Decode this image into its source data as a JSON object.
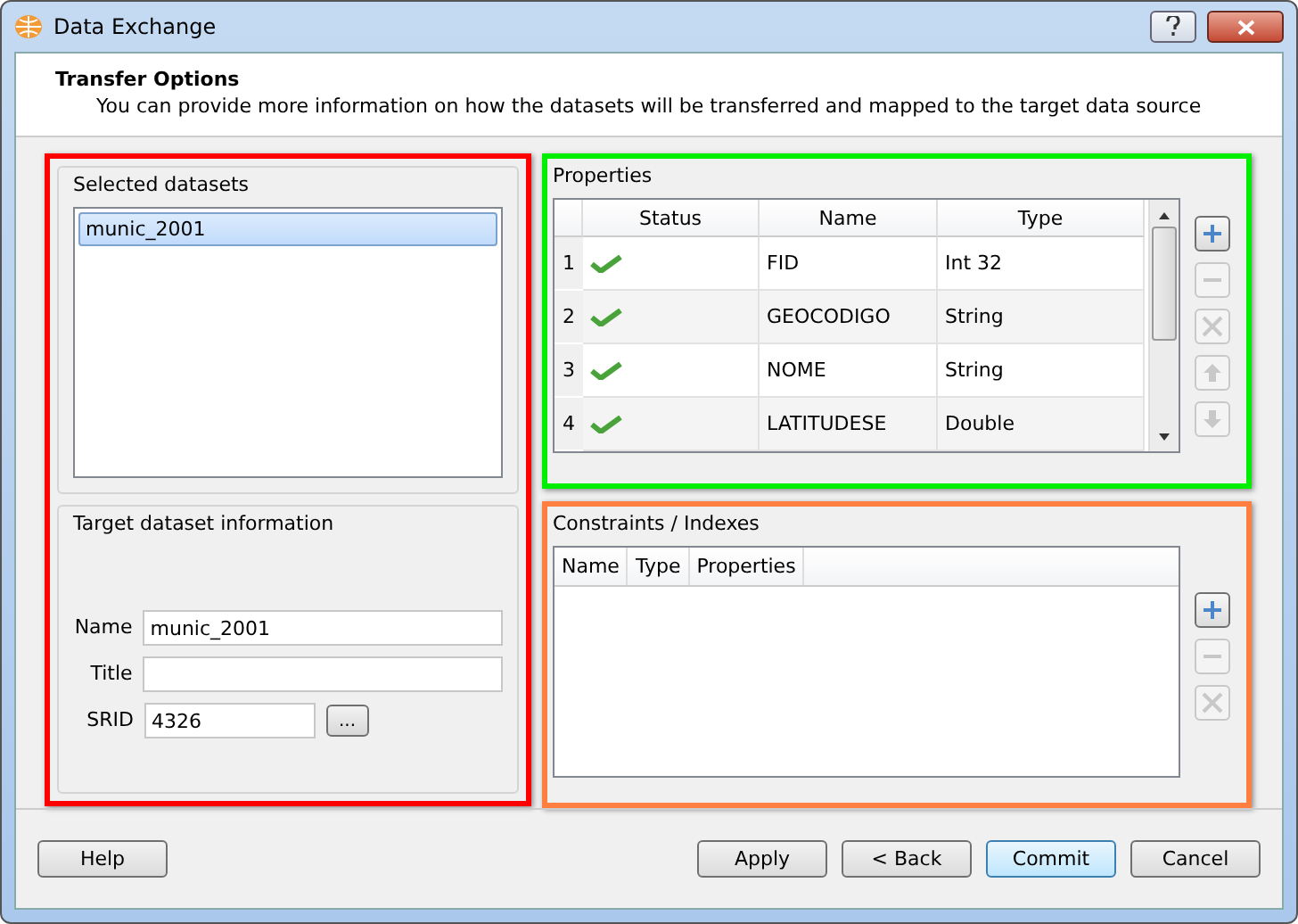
{
  "window": {
    "title": "Data Exchange"
  },
  "header": {
    "title": "Transfer Options",
    "subtitle": "You can provide more information on how the datasets will be transferred and mapped to the target data source"
  },
  "selected_datasets": {
    "title": "Selected datasets",
    "color": "#ff0000",
    "items": [
      {
        "label": "munic_2001",
        "selected": true
      }
    ]
  },
  "target_info": {
    "title": "Target dataset information",
    "fields": [
      {
        "label": "Name",
        "value": "munic_2001"
      },
      {
        "label": "Title"
      },
      {
        "label": "SRID",
        "value": "4326",
        "browse": "..."
      }
    ]
  },
  "properties": {
    "title": "Properties",
    "color": "#00ee00",
    "columns": [
      "Status",
      "Name",
      "Type"
    ],
    "rows": [
      {
        "number": "1",
        "ok": true,
        "name": "FID",
        "type": "Int 32"
      },
      {
        "number": "2",
        "ok": true,
        "name": "GEOCODIGO",
        "type": "String"
      },
      {
        "number": "3",
        "ok": true,
        "name": "NOME",
        "type": "String"
      },
      {
        "number": "4",
        "ok": true,
        "name": "LATITUDESE",
        "type": "Double"
      }
    ],
    "tools": [
      {
        "kind": "add",
        "disabled": false
      },
      {
        "kind": "remove",
        "disabled": true
      },
      {
        "kind": "edit",
        "disabled": true
      },
      {
        "kind": "up",
        "disabled": true
      },
      {
        "kind": "down",
        "disabled": true
      }
    ]
  },
  "constraints": {
    "title": "Constraints / Indexes",
    "color": "#ff7f40",
    "columns": [
      "Name",
      "Type",
      "Properties"
    ],
    "tools": [
      {
        "kind": "add",
        "disabled": false
      },
      {
        "kind": "remove",
        "disabled": true
      },
      {
        "kind": "edit",
        "disabled": true
      }
    ]
  },
  "buttons": [
    {
      "label": "Help",
      "default": false
    },
    {
      "label": "Apply",
      "default": false
    },
    {
      "label": "< Back",
      "default": false
    },
    {
      "label": "Commit",
      "default": true
    },
    {
      "label": "Cancel",
      "default": false
    }
  ]
}
